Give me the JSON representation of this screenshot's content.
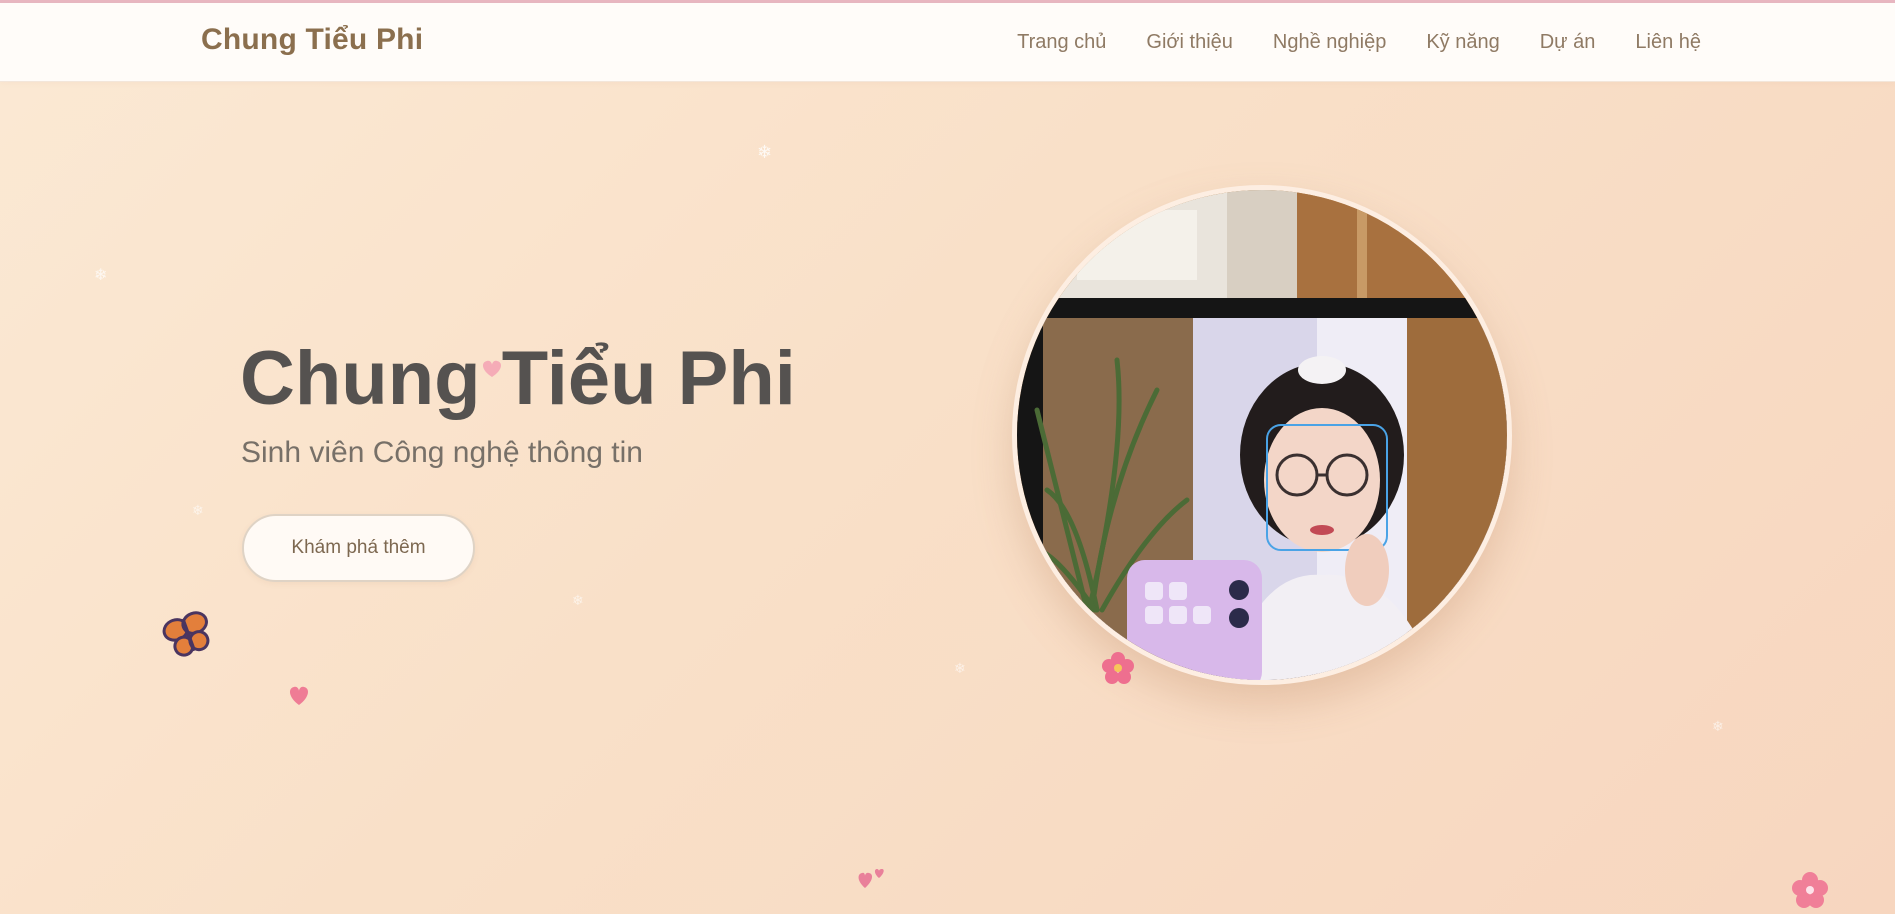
{
  "navbar": {
    "brand": "Chung Tiểu Phi",
    "links": [
      "Trang chủ",
      "Giới thiệu",
      "Nghề nghiệp",
      "Kỹ năng",
      "Dự án",
      "Liên hệ"
    ]
  },
  "hero": {
    "title": "Chung Tiểu Phi",
    "subtitle": "Sinh viên Công nghệ thông tin",
    "cta_label": "Khám phá thêm"
  },
  "decorations": [
    "butterfly-icon",
    "heart-icon",
    "flower-icon",
    "snowflake-icon"
  ],
  "colors": {
    "background_start": "#fbe9d4",
    "background_end": "#f7d6bf",
    "brand": "#8b6f4e",
    "title": "#555250",
    "accent_pink": "#e98ba3"
  }
}
